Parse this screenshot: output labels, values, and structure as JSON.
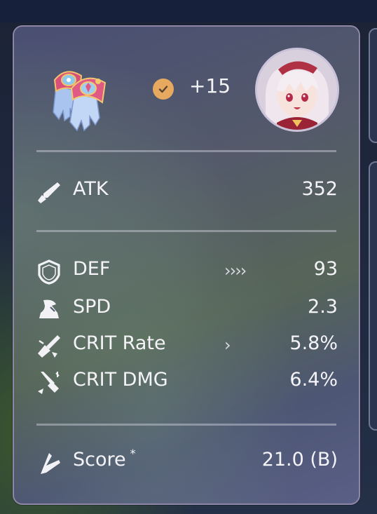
{
  "header": {
    "relic_icon": "glove-relic-icon",
    "level_badge_icon": "check-icon",
    "level_text": "+15",
    "avatar_icon": "character-portrait"
  },
  "main_stat": {
    "label": "ATK",
    "value": "352",
    "icon": "sword-icon"
  },
  "sub_stats": [
    {
      "label": "DEF",
      "value": "93",
      "rolls": "››››",
      "icon": "shield-icon"
    },
    {
      "label": "SPD",
      "value": "2.3",
      "rolls": "",
      "icon": "boot-icon"
    },
    {
      "label": "CRIT Rate",
      "value": "5.8%",
      "rolls": "›",
      "icon": "crit-rate-icon"
    },
    {
      "label": "CRIT DMG",
      "value": "6.4%",
      "rolls": "",
      "icon": "crit-dmg-icon"
    }
  ],
  "score": {
    "label": "Score",
    "asterisk": "*",
    "value": "21.0 (B)",
    "icon": "score-icon"
  },
  "colors": {
    "level_badge": "#e7a960",
    "card_border": "#8d86a6",
    "text": "#f4f4f8"
  }
}
